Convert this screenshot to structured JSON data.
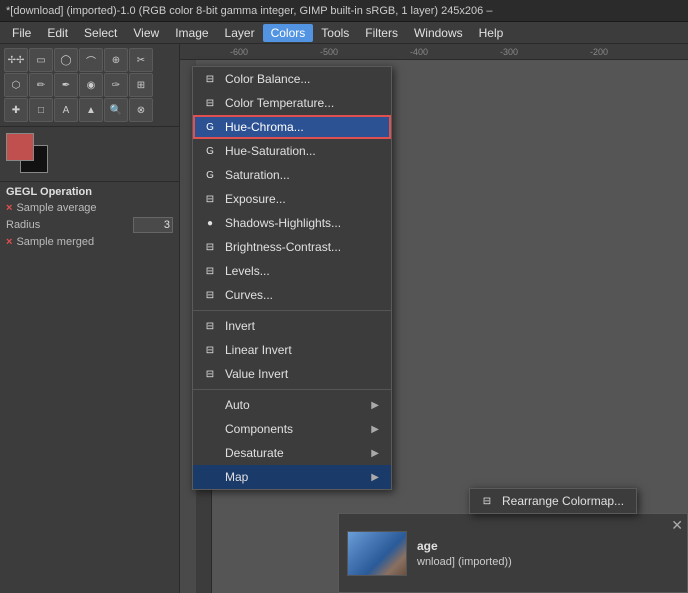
{
  "titleBar": {
    "text": "*[download] (imported)-1.0 (RGB color 8-bit gamma integer, GIMP built-in sRGB, 1 layer) 245x206 –"
  },
  "menuBar": {
    "items": [
      "File",
      "Edit",
      "Select",
      "View",
      "Image",
      "Layer",
      "Colors",
      "Tools",
      "Filters",
      "Windows",
      "Help"
    ]
  },
  "colorsMenu": {
    "items": [
      {
        "id": "color-balance",
        "icon": "grid-icon",
        "label": "Color Balance...",
        "hasSubmenu": false
      },
      {
        "id": "color-temperature",
        "icon": "grid-icon",
        "label": "Color Temperature...",
        "hasSubmenu": false
      },
      {
        "id": "hue-chroma",
        "icon": "gegl-icon",
        "label": "Hue-Chroma...",
        "hasSubmenu": false,
        "highlighted": true
      },
      {
        "id": "hue-saturation",
        "icon": "gegl-icon",
        "label": "Hue-Saturation...",
        "hasSubmenu": false
      },
      {
        "id": "saturation",
        "icon": "gegl-icon",
        "label": "Saturation...",
        "hasSubmenu": false
      },
      {
        "id": "exposure",
        "icon": "gegl-icon",
        "label": "Exposure...",
        "hasSubmenu": false
      },
      {
        "id": "shadows-highlights",
        "icon": "circle-icon",
        "label": "Shadows-Highlights...",
        "hasSubmenu": false
      },
      {
        "id": "brightness-contrast",
        "icon": "grid-icon",
        "label": "Brightness-Contrast...",
        "hasSubmenu": false
      },
      {
        "id": "levels",
        "icon": "grid-icon",
        "label": "Levels...",
        "hasSubmenu": false
      },
      {
        "id": "curves",
        "icon": "grid-icon",
        "label": "Curves...",
        "hasSubmenu": false
      },
      {
        "id": "invert",
        "icon": "grid-icon",
        "label": "Invert",
        "hasSubmenu": false,
        "separatorAbove": true
      },
      {
        "id": "linear-invert",
        "icon": "grid-icon",
        "label": "Linear Invert",
        "hasSubmenu": false
      },
      {
        "id": "value-invert",
        "icon": "grid-icon",
        "label": "Value Invert",
        "hasSubmenu": false
      },
      {
        "id": "auto",
        "icon": null,
        "label": "Auto",
        "hasSubmenu": true,
        "separatorAbove": true
      },
      {
        "id": "components",
        "icon": null,
        "label": "Components",
        "hasSubmenu": true
      },
      {
        "id": "desaturate",
        "icon": null,
        "label": "Desaturate",
        "hasSubmenu": true
      },
      {
        "id": "map",
        "icon": null,
        "label": "Map",
        "hasSubmenu": true,
        "activeItem": true
      }
    ]
  },
  "mapSubmenu": {
    "items": [
      {
        "label": "Rearrange Colormap...",
        "id": "rearrange-colormap"
      }
    ]
  },
  "gegl": {
    "title": "GEGL Operation",
    "closeLabel": "×",
    "sampleLabel": "Sample average",
    "radiusLabel": "Radius",
    "radiusValue": "3",
    "mergedLabel": "Sample merged"
  },
  "bottomPanel": {
    "title": "age",
    "subtitle": "wnload] (imported))",
    "submenuItem": "Rearrange Colormap..."
  }
}
